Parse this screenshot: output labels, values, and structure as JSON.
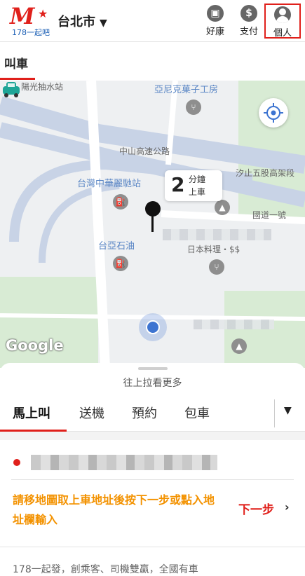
{
  "header": {
    "logo_letter": "M",
    "logo_sub": "178一起吧",
    "city": "台北市",
    "buttons": [
      {
        "label": "好康",
        "icon": "gift-icon"
      },
      {
        "label": "支付",
        "icon": "dollar-icon"
      },
      {
        "label": "個人",
        "icon": "person-icon"
      }
    ]
  },
  "page": {
    "title": "叫車"
  },
  "map": {
    "labels": {
      "station": "陽光抽水站",
      "restaurant": "亞尼克菓子工房",
      "highway": "中山高速公路",
      "elevated": "汐止五股高架段",
      "taxi_stand": "台灣中華麗馳站",
      "gas": "台亞石油",
      "japanese": "日本料理・$$",
      "national_road": "國道一號",
      "google": "Google"
    },
    "eta": {
      "number": "2",
      "unit_top": "分鐘",
      "unit_bottom": "上車"
    }
  },
  "sheet": {
    "pull_text": "往上拉看更多",
    "tabs": [
      "馬上叫",
      "送機",
      "預約",
      "包車"
    ],
    "active_tab": 0,
    "hint": "請移地圖取上車地址後按下一步或點入地址欄輸入",
    "next_label": "下一步",
    "footer": "178一起發，創乘客、司機雙贏，全國有車"
  },
  "colors": {
    "brand_red": "#e0201b",
    "hint_orange": "#f39200",
    "logo_blue": "#1b5fb5"
  }
}
